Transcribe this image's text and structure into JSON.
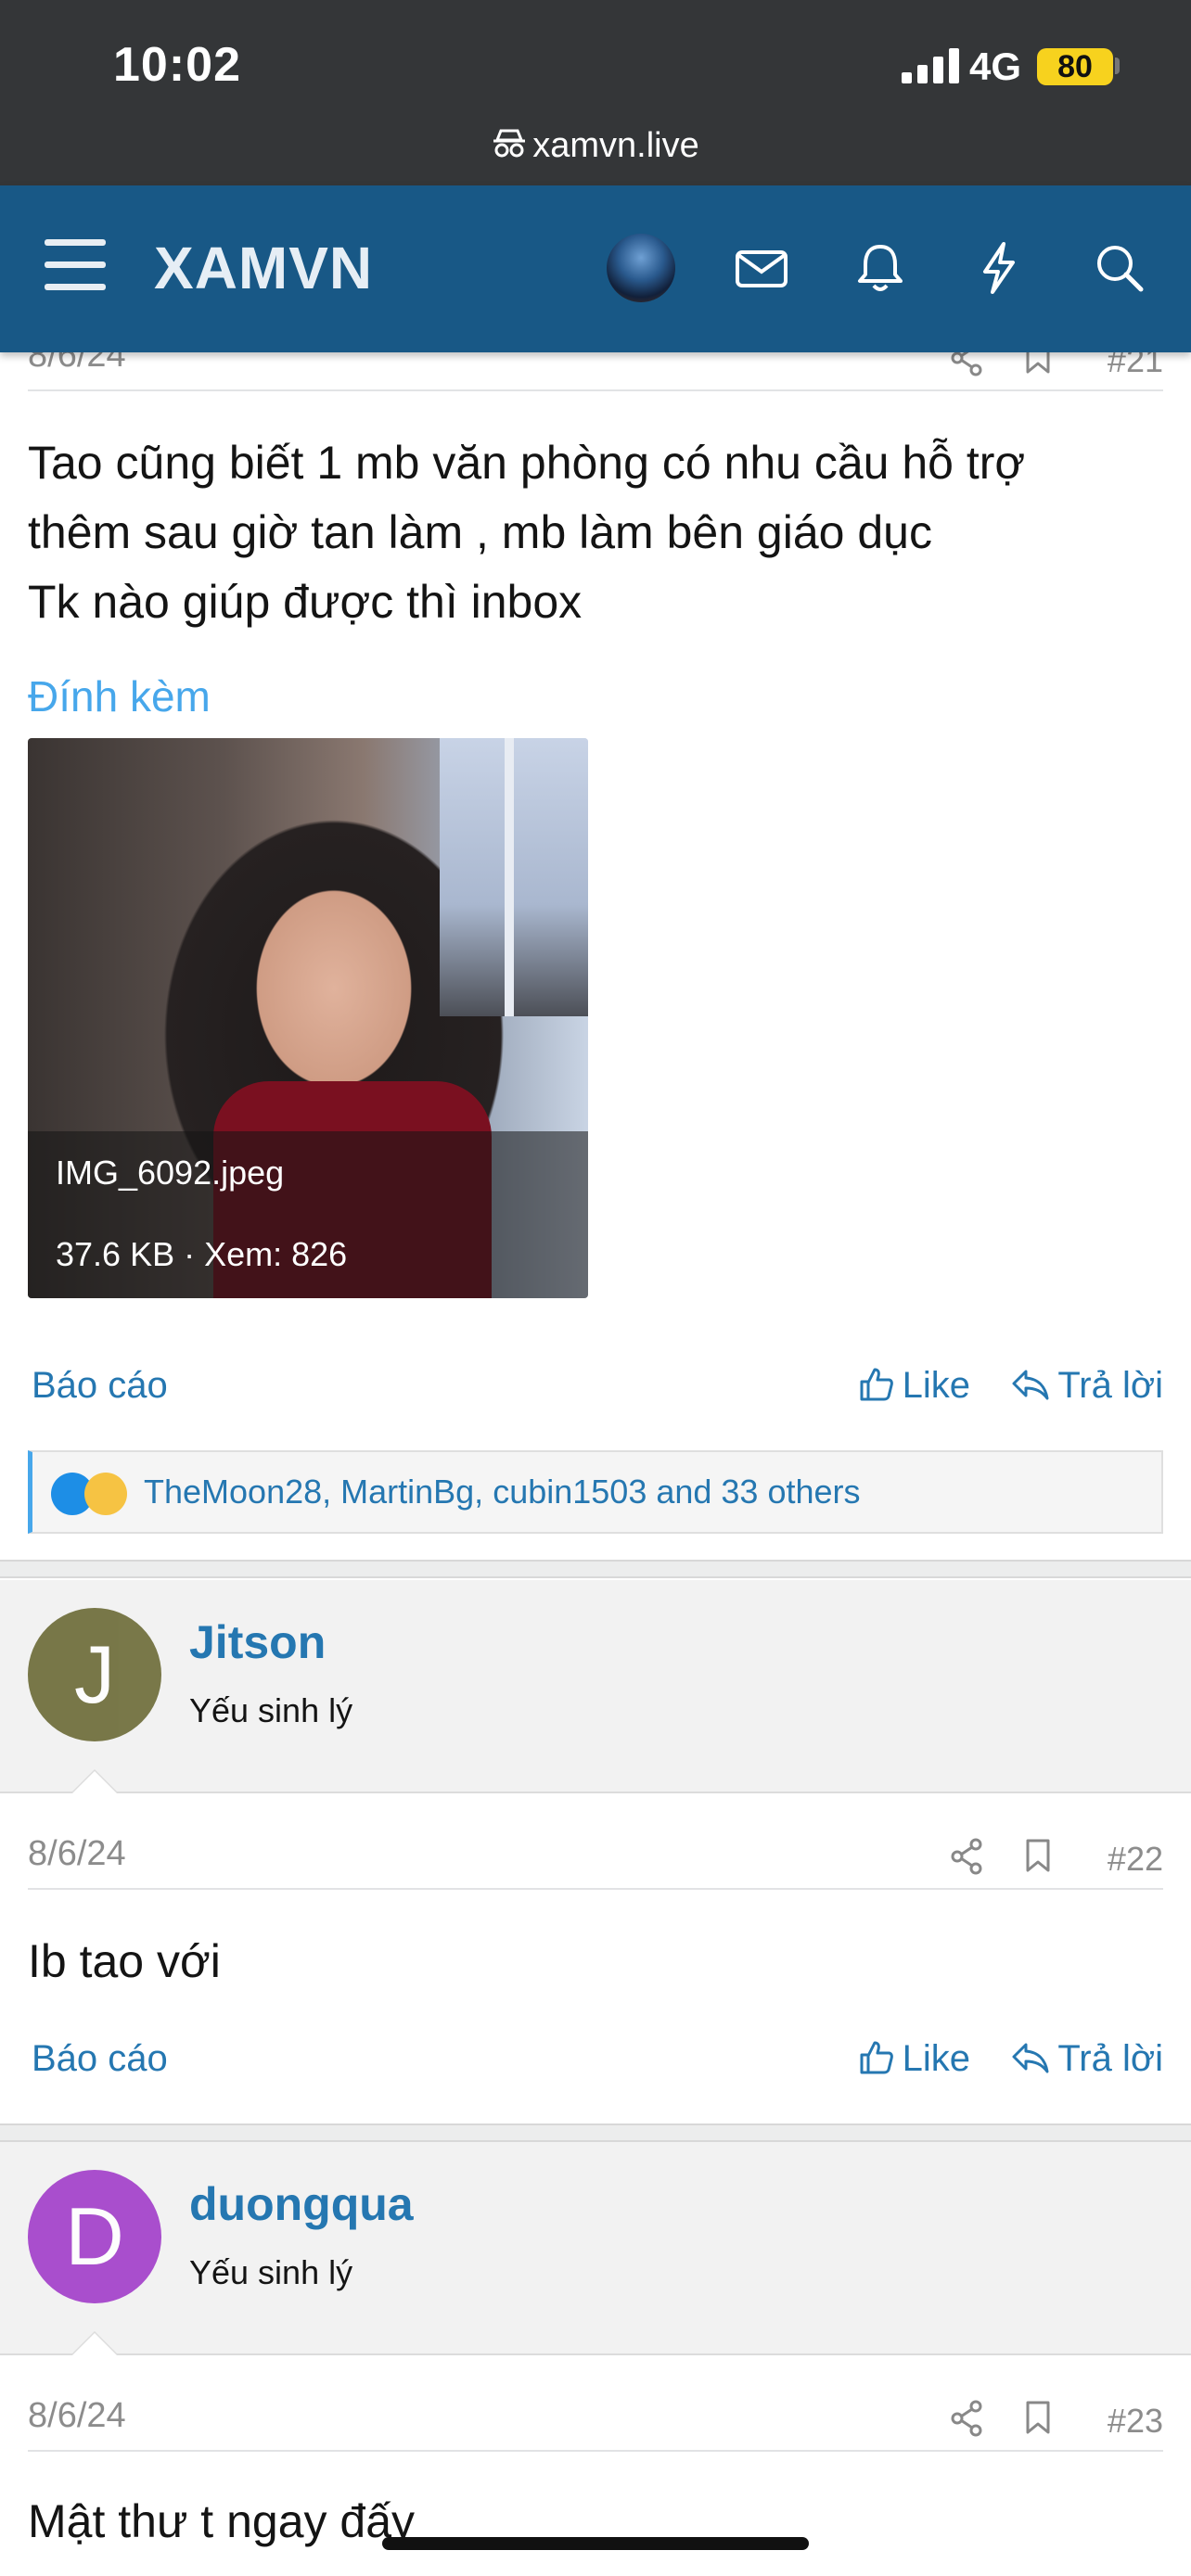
{
  "status_bar": {
    "time": "10:02",
    "network": "4G",
    "battery": "80"
  },
  "browser": {
    "url": "xamvn.live"
  },
  "site_header": {
    "logo": "XAMVN"
  },
  "post21": {
    "date": "8/6/24",
    "number": "#21",
    "lines": [
      "Tao cũng biết 1 mb văn phòng có nhu cầu hỗ trợ",
      "thêm sau giờ tan làm , mb làm bên giáo dục",
      "Tk nào giúp được thì inbox"
    ],
    "attachments_label": "Đính kèm",
    "attachment": {
      "filename": "IMG_6092.jpeg",
      "info": "37.6 KB · Xem: 826"
    },
    "report_label": "Báo cáo",
    "like_label": "Like",
    "reply_label": "Trả lời",
    "reactions_text": "TheMoon28, MartinBg, cubin1503 and 33 others"
  },
  "user22": {
    "initial": "J",
    "name": "Jitson",
    "title": "Yếu sinh lý",
    "avatar_color": "#6b6a36"
  },
  "post22": {
    "date": "8/6/24",
    "number": "#22",
    "text": "Ib tao với",
    "report_label": "Báo cáo",
    "like_label": "Like",
    "reply_label": "Trả lời"
  },
  "user23": {
    "initial": "D",
    "name": "duongqua",
    "title": "Yếu sinh lý",
    "avatar_color": "#a23dc9"
  },
  "post23": {
    "date": "8/6/24",
    "number": "#23",
    "text": "Mật thư t ngay đấy"
  },
  "colors": {
    "header_bg": "#185886",
    "link": "#2577b1",
    "attach_title": "#47a7eb"
  }
}
